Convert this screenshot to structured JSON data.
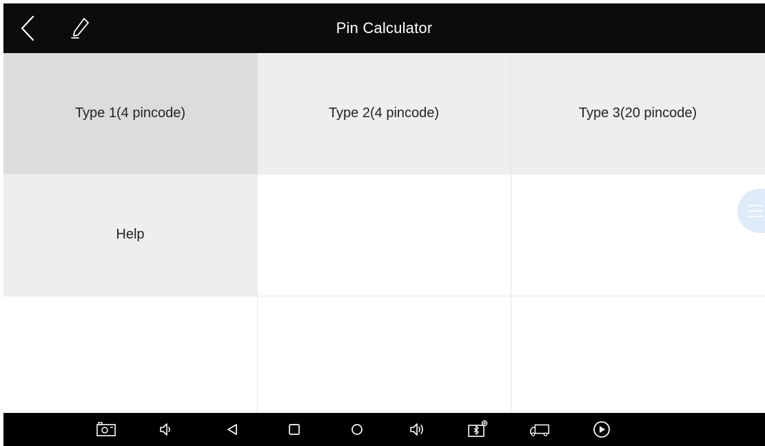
{
  "header": {
    "title": "Pin Calculator",
    "back_icon": "chevron-left-icon",
    "edit_icon": "pen-icon"
  },
  "menu": {
    "items": [
      {
        "label": "Type 1(4 pincode)",
        "selected": true
      },
      {
        "label": "Type 2(4 pincode)",
        "selected": false
      },
      {
        "label": "Type 3(20 pincode)",
        "selected": false
      },
      {
        "label": "Help",
        "selected": false
      }
    ]
  },
  "colors": {
    "header_bg": "#0c0c0c",
    "selected_cell": "#dcdcdc",
    "item_cell": "#eeeeee",
    "empty_cell": "#ffffff",
    "nav_bg": "#000000"
  },
  "nav_bar": {
    "icons": [
      "screenshot-icon",
      "volume-down-icon",
      "back-triangle-icon",
      "recent-apps-icon",
      "home-circle-icon",
      "volume-up-icon",
      "vci-connection-icon",
      "truck-icon",
      "play-circle-icon"
    ]
  },
  "floating_button": {
    "icon": "menu-lines-icon"
  }
}
